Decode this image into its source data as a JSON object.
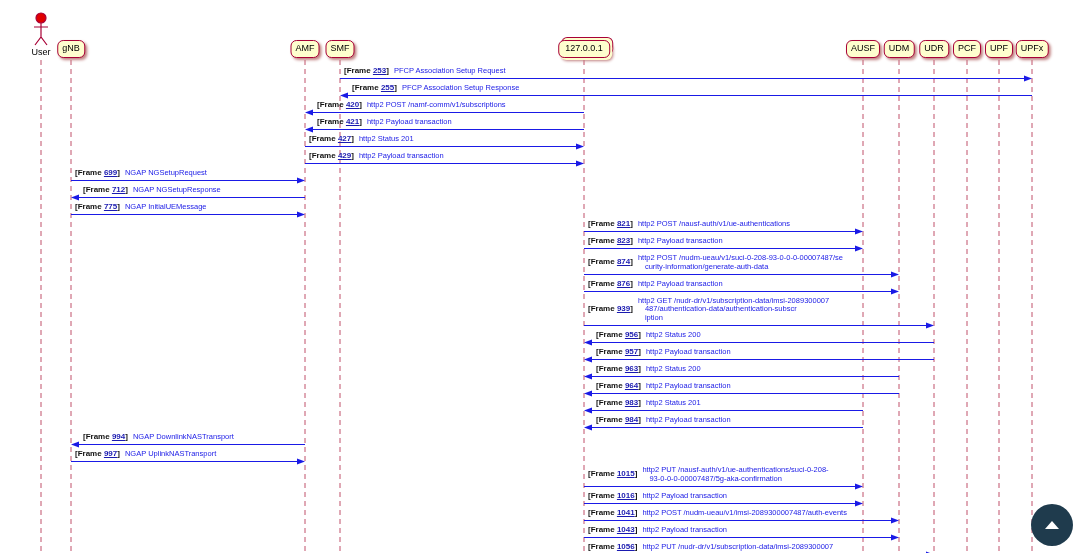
{
  "participants": [
    {
      "name": "User",
      "kind": "actor"
    },
    {
      "name": "gNB",
      "kind": "box"
    },
    {
      "name": "AMF",
      "kind": "box"
    },
    {
      "name": "SMF",
      "kind": "box"
    },
    {
      "name": "127.0.0.1",
      "kind": "stacked"
    },
    {
      "name": "AUSF",
      "kind": "box"
    },
    {
      "name": "UDM",
      "kind": "box"
    },
    {
      "name": "UDR",
      "kind": "box"
    },
    {
      "name": "PCF",
      "kind": "box"
    },
    {
      "name": "UPF",
      "kind": "box"
    },
    {
      "name": "UPFx",
      "kind": "box"
    }
  ],
  "messages": [
    {
      "kind": "smf_to_upfx",
      "prefix": "[Frame",
      "frame": "253",
      "suffix": "]",
      "lines": [
        "PFCP Association Setup Request"
      ]
    },
    {
      "kind": "upfx_to_smf",
      "prefix": "[Frame",
      "frame": "255",
      "suffix": "]",
      "lines": [
        "PFCP Association Setup Response"
      ]
    },
    {
      "kind": "host_to_amf",
      "prefix": "[Frame",
      "frame": "420",
      "suffix": "]",
      "lines": [
        "http2 POST /namf-comm/v1/subscriptions"
      ]
    },
    {
      "kind": "host_to_amf",
      "prefix": "[Frame",
      "frame": "421",
      "suffix": "]",
      "lines": [
        "http2 Payload transaction"
      ]
    },
    {
      "kind": "amf_to_host",
      "prefix": "[Frame",
      "frame": "427",
      "suffix": "]",
      "lines": [
        "http2 Status 201"
      ]
    },
    {
      "kind": "amf_to_host",
      "prefix": "[Frame",
      "frame": "429",
      "suffix": "]",
      "lines": [
        "http2 Payload transaction"
      ]
    },
    {
      "kind": "gnb_to_amf",
      "prefix": "[Frame",
      "frame": "699",
      "suffix": "]",
      "lines": [
        "NGAP NGSetupRequest"
      ]
    },
    {
      "kind": "amf_to_gnb",
      "prefix": "[Frame",
      "frame": "712",
      "suffix": "]",
      "lines": [
        "NGAP NGSetupResponse"
      ]
    },
    {
      "kind": "gnb_to_amf",
      "prefix": "[Frame",
      "frame": "775",
      "suffix": "]",
      "lines": [
        "NGAP InitialUEMessage"
      ]
    },
    {
      "kind": "host_to_ausf",
      "prefix": "[Frame",
      "frame": "821",
      "suffix": "]",
      "lines": [
        "http2 POST /nausf-auth/v1/ue-authentications"
      ]
    },
    {
      "kind": "host_to_ausf",
      "prefix": "[Frame",
      "frame": "823",
      "suffix": "]",
      "lines": [
        "http2 Payload transaction"
      ]
    },
    {
      "kind": "host_to_udm",
      "prefix": "[Frame",
      "frame": "874",
      "suffix": "]",
      "lines": [
        "http2 POST /nudm-ueau/v1/suci-0-208-93-0-0-0-00007487/se",
        "curity-information/generate-auth-data"
      ]
    },
    {
      "kind": "host_to_udm",
      "prefix": "[Frame",
      "frame": "876",
      "suffix": "]",
      "lines": [
        "http2 Payload transaction"
      ]
    },
    {
      "kind": "host_to_udr",
      "prefix": "[Frame",
      "frame": "939",
      "suffix": "]",
      "lines": [
        "http2 GET /nudr-dr/v1/subscription-data/imsi-2089300007",
        "487/authentication-data/authentication-subscr",
        "iption"
      ]
    },
    {
      "kind": "udr_to_host",
      "prefix": "[Frame",
      "frame": "956",
      "suffix": "]",
      "lines": [
        "http2 Status 200"
      ]
    },
    {
      "kind": "udr_to_host",
      "prefix": "[Frame",
      "frame": "957",
      "suffix": "]",
      "lines": [
        "http2 Payload transaction"
      ]
    },
    {
      "kind": "udm_to_host",
      "prefix": "[Frame",
      "frame": "963",
      "suffix": "]",
      "lines": [
        "http2 Status 200"
      ]
    },
    {
      "kind": "udm_to_host",
      "prefix": "[Frame",
      "frame": "964",
      "suffix": "]",
      "lines": [
        "http2 Payload transaction"
      ]
    },
    {
      "kind": "ausf_to_host",
      "prefix": "[Frame",
      "frame": "983",
      "suffix": "]",
      "lines": [
        "http2 Status 201"
      ]
    },
    {
      "kind": "ausf_to_host",
      "prefix": "[Frame",
      "frame": "984",
      "suffix": "]",
      "lines": [
        "http2 Payload transaction"
      ]
    },
    {
      "kind": "amf_to_gnb",
      "prefix": "[Frame",
      "frame": "994",
      "suffix": "]",
      "lines": [
        "NGAP DownlinkNASTransport"
      ]
    },
    {
      "kind": "gnb_to_amf",
      "prefix": "[Frame",
      "frame": "997",
      "suffix": "]",
      "lines": [
        "NGAP UplinkNASTransport"
      ]
    },
    {
      "kind": "host_to_ausf",
      "prefix": "[Frame",
      "frame": "1015",
      "suffix": "]",
      "lines": [
        "http2 PUT /nausf-auth/v1/ue-authentications/suci-0-208-",
        "93-0-0-0-00007487/5g-aka-confirmation"
      ]
    },
    {
      "kind": "host_to_ausf",
      "prefix": "[Frame",
      "frame": "1016",
      "suffix": "]",
      "lines": [
        "http2 Payload transaction"
      ]
    },
    {
      "kind": "host_to_udm",
      "prefix": "[Frame",
      "frame": "1041",
      "suffix": "]",
      "lines": [
        "http2 POST /nudm-ueau/v1/imsi-2089300007487/auth-events"
      ]
    },
    {
      "kind": "host_to_udm",
      "prefix": "[Frame",
      "frame": "1043",
      "suffix": "]",
      "lines": [
        "http2 Payload transaction"
      ]
    },
    {
      "kind": "host_to_udr",
      "prefix": "[Frame",
      "frame": "1056",
      "suffix": "]",
      "lines": [
        "http2 PUT /nudr-dr/v1/subscription-data/imsi-2089300007"
      ]
    }
  ]
}
